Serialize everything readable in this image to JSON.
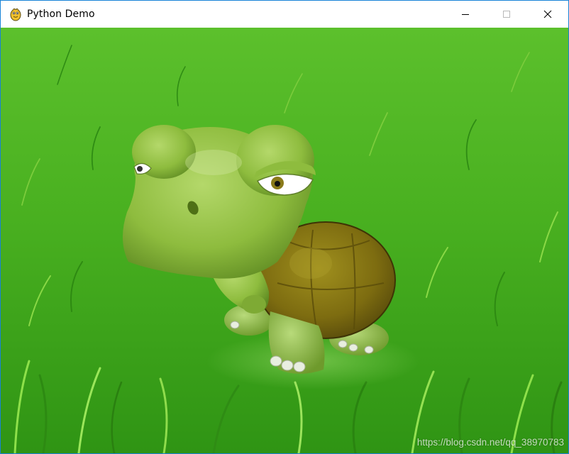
{
  "window": {
    "title": "Python Demo",
    "app_icon": "pygame-snake-icon",
    "controls": [
      "minimize-icon",
      "maximize-icon",
      "close-icon"
    ],
    "border_color": "#1883d7"
  },
  "scene": {
    "background": "grass-field",
    "sprite": "cartoon-turtle",
    "grass_color": "#3aa51c",
    "turtle_skin_color": "#8fbc3c",
    "turtle_shell_color": "#7a6a10"
  },
  "watermark": {
    "text": "https://blog.csdn.net/qq_38970783"
  }
}
